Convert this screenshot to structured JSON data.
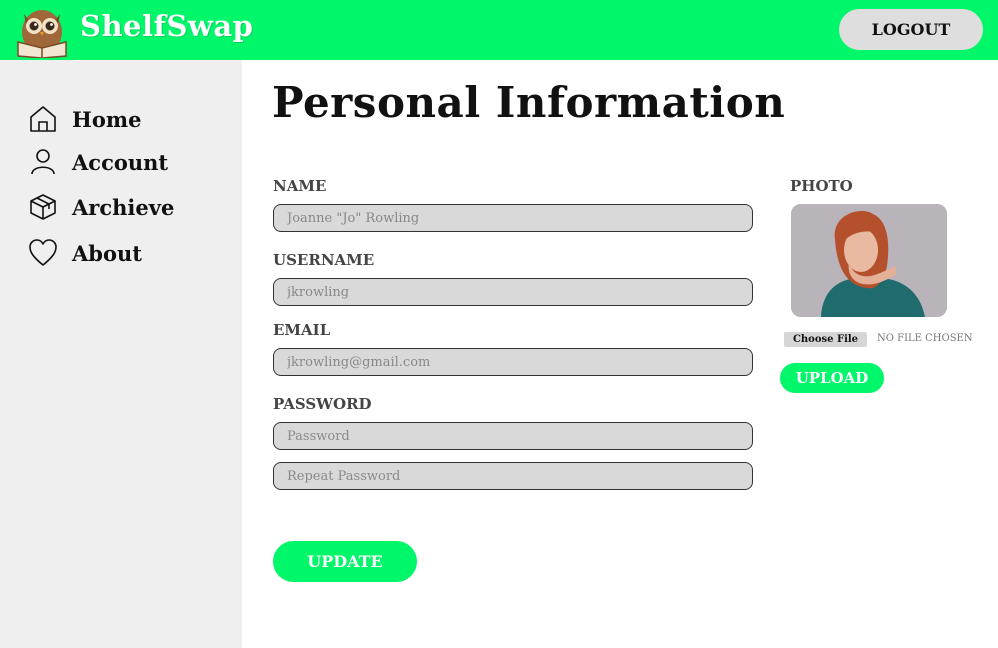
{
  "app": {
    "name": "ShelfSwap",
    "brand_color": "#00f76a",
    "logout_label": "LOGOUT"
  },
  "sidebar": {
    "items": [
      {
        "label": "Home",
        "icon": "home-icon"
      },
      {
        "label": "Account",
        "icon": "user-icon"
      },
      {
        "label": "Archieve",
        "icon": "box-icon"
      },
      {
        "label": "About",
        "icon": "heart-icon"
      }
    ]
  },
  "page": {
    "title": "Personal Information"
  },
  "form": {
    "name_label": "NAME",
    "name_value": "Joanne \"Jo\" Rowling",
    "username_label": "USERNAME",
    "username_value": "jkrowling",
    "email_label": "EMAIL",
    "email_value": "jkrowling@gmail.com",
    "password_label": "PASSWORD",
    "password_placeholder": "Password",
    "repeat_placeholder": "Repeat Password",
    "update_label": "UPDATE"
  },
  "photo": {
    "label": "PHOTO",
    "choose_file_label": "Choose File",
    "file_status": "NO FILE CHOSEN",
    "upload_label": "UPLOAD"
  }
}
